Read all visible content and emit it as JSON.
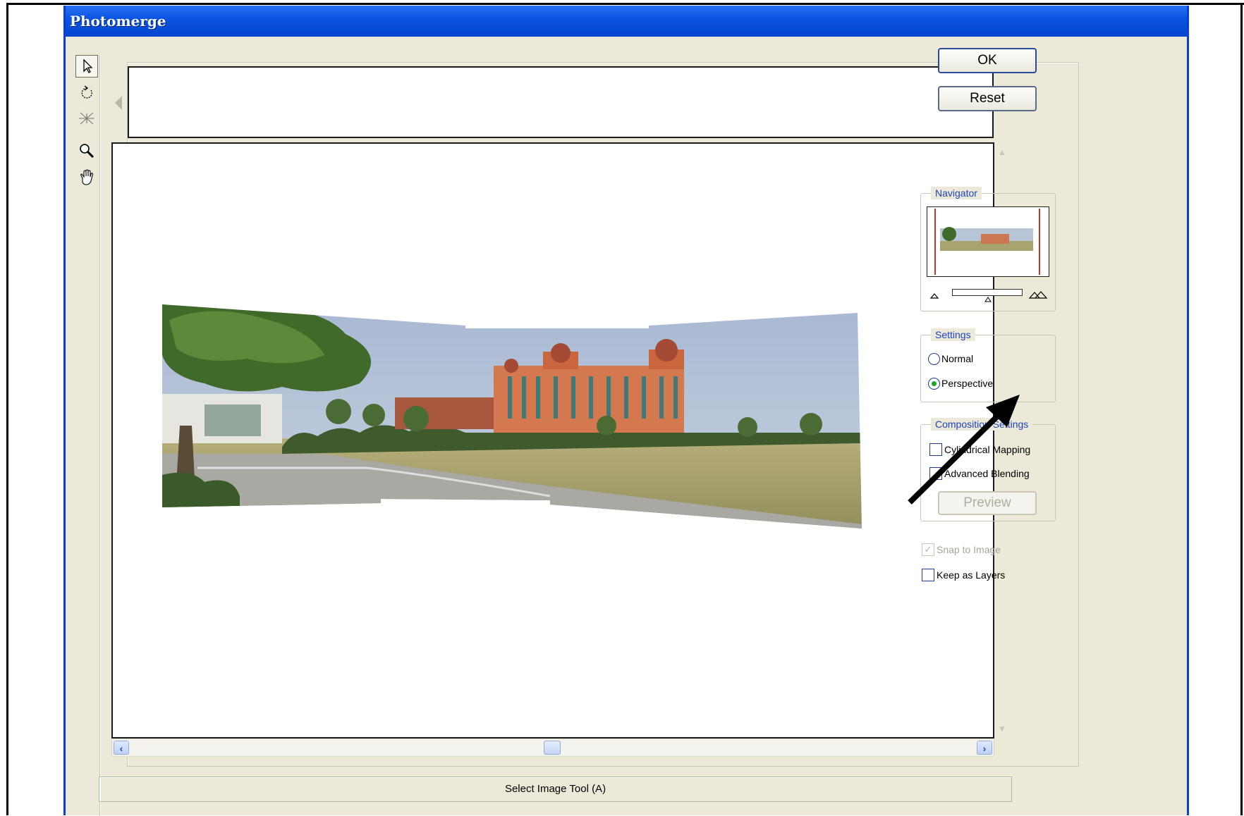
{
  "window": {
    "title": "Photomerge"
  },
  "tools": [
    {
      "name": "select-image-tool",
      "icon": "arrow-pointer-icon",
      "active": true
    },
    {
      "name": "rotate-image-tool",
      "icon": "rotate-icon",
      "active": false
    },
    {
      "name": "vanishing-point-tool",
      "icon": "vanishing-point-icon",
      "active": false
    },
    {
      "name": "zoom-tool",
      "icon": "magnifier-icon",
      "active": false
    },
    {
      "name": "hand-tool",
      "icon": "hand-icon",
      "active": false
    }
  ],
  "buttons": {
    "ok": "OK",
    "reset": "Reset",
    "preview": "Preview"
  },
  "navigator": {
    "title": "Navigator"
  },
  "settings": {
    "title": "Settings",
    "options": [
      {
        "label": "Normal",
        "checked": false
      },
      {
        "label": "Perspective",
        "checked": true
      }
    ]
  },
  "composition": {
    "title": "Composition Settings",
    "cylindrical_mapping": {
      "label": "Cylindrical Mapping",
      "checked": false
    },
    "advanced_blending": {
      "label": "Advanced Blending",
      "checked": false
    }
  },
  "snap_to_image": {
    "label": "Snap to Image",
    "checked": true,
    "enabled": false
  },
  "keep_as_layers": {
    "label": "Keep as Layers",
    "checked": false
  },
  "status": {
    "text": "Select Image Tool (A)"
  },
  "colors": {
    "title_blue": "#0a55e2",
    "group_title": "#1d43c3",
    "dialog_bg": "#ece9d8"
  }
}
